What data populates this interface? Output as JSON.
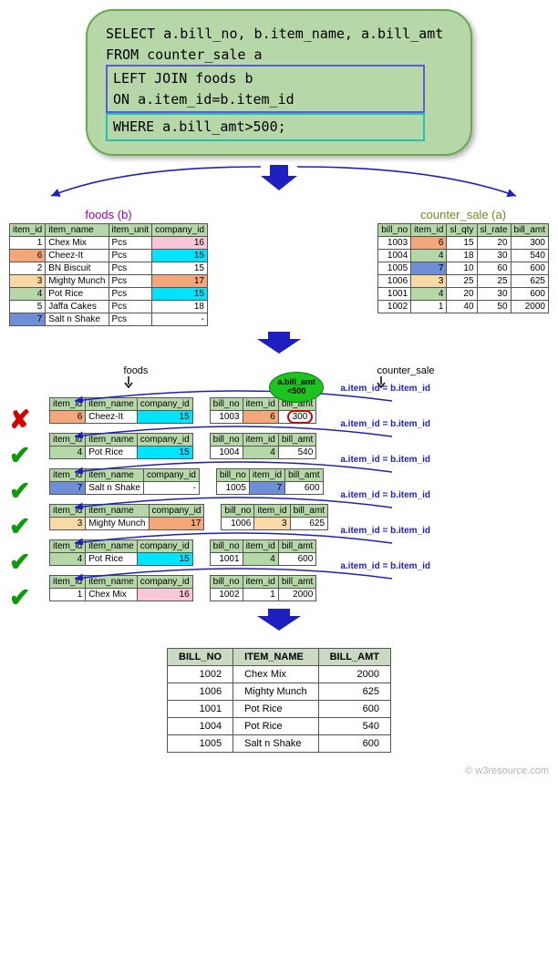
{
  "sql": {
    "line1": "SELECT a.bill_no, b.item_name, a.bill_amt",
    "line2": "FROM counter_sale a",
    "join1": "LEFT JOIN foods b",
    "join2": "ON a.item_id=b.item_id",
    "where": "WHERE  a.bill_amt>500;"
  },
  "labels": {
    "foods_b": "foods (b)",
    "counter_sale_a": "counter_sale (a)",
    "foods": "foods",
    "counter_sale": "counter_sale",
    "join_cond": "a.item_id = b.item_id",
    "bubble": "a.bill_amt\n<500"
  },
  "foods": {
    "headers": [
      "item_id",
      "item_name",
      "item_unit",
      "company_id"
    ],
    "rows": [
      {
        "id": "1",
        "name": "Chex Mix",
        "unit": "Pcs",
        "co": "16",
        "id_bg": "c-white",
        "co_bg": "c-pink"
      },
      {
        "id": "6",
        "name": "Cheez-It",
        "unit": "Pcs",
        "co": "15",
        "id_bg": "c-salmon",
        "co_bg": "c-cyan"
      },
      {
        "id": "2",
        "name": "BN Biscuit",
        "unit": "Pcs",
        "co": "15",
        "id_bg": "c-white",
        "co_bg": "c-white"
      },
      {
        "id": "3",
        "name": "Mighty Munch",
        "unit": "Pcs",
        "co": "17",
        "id_bg": "c-peach",
        "co_bg": "c-salmon"
      },
      {
        "id": "4",
        "name": "Pot Rice",
        "unit": "Pcs",
        "co": "15",
        "id_bg": "c-ltgreen",
        "co_bg": "c-cyan"
      },
      {
        "id": "5",
        "name": "Jaffa Cakes",
        "unit": "Pcs",
        "co": "18",
        "id_bg": "c-white",
        "co_bg": "c-white"
      },
      {
        "id": "7",
        "name": "Salt n Shake",
        "unit": "Pcs",
        "co": "-",
        "id_bg": "c-blue",
        "co_bg": "c-white"
      }
    ]
  },
  "counter": {
    "headers": [
      "bill_no",
      "item_id",
      "sl_qty",
      "sl_rate",
      "bill_amt"
    ],
    "rows": [
      {
        "bill": "1003",
        "item": "6",
        "qty": "15",
        "rate": "20",
        "amt": "300",
        "item_bg": "c-salmon"
      },
      {
        "bill": "1004",
        "item": "4",
        "qty": "18",
        "rate": "30",
        "amt": "540",
        "item_bg": "c-ltgreen"
      },
      {
        "bill": "1005",
        "item": "7",
        "qty": "10",
        "rate": "60",
        "amt": "600",
        "item_bg": "c-blue"
      },
      {
        "bill": "1006",
        "item": "3",
        "qty": "25",
        "rate": "25",
        "amt": "625",
        "item_bg": "c-peach"
      },
      {
        "bill": "1001",
        "item": "4",
        "qty": "20",
        "rate": "30",
        "amt": "600",
        "item_bg": "c-ltgreen"
      },
      {
        "bill": "1002",
        "item": "1",
        "qty": "40",
        "rate": "50",
        "amt": "2000",
        "item_bg": "c-white"
      }
    ]
  },
  "steps": [
    {
      "ok": false,
      "f": {
        "id": "6",
        "name": "Cheez-It",
        "co": "15",
        "id_bg": "c-salmon",
        "co_bg": "c-cyan"
      },
      "c": {
        "bill": "1003",
        "item": "6",
        "amt": "300",
        "item_bg": "c-salmon"
      },
      "circle": true,
      "bubble": true
    },
    {
      "ok": true,
      "f": {
        "id": "4",
        "name": "Pot Rice",
        "co": "15",
        "id_bg": "c-ltgreen",
        "co_bg": "c-cyan"
      },
      "c": {
        "bill": "1004",
        "item": "4",
        "amt": "540",
        "item_bg": "c-ltgreen"
      }
    },
    {
      "ok": true,
      "f": {
        "id": "7",
        "name": "Salt n Shake",
        "co": "-",
        "id_bg": "c-blue",
        "co_bg": "c-white"
      },
      "c": {
        "bill": "1005",
        "item": "7",
        "amt": "600",
        "item_bg": "c-blue"
      }
    },
    {
      "ok": true,
      "f": {
        "id": "3",
        "name": "Mighty Munch",
        "co": "17",
        "id_bg": "c-peach",
        "co_bg": "c-salmon"
      },
      "c": {
        "bill": "1006",
        "item": "3",
        "amt": "625",
        "item_bg": "c-peach"
      }
    },
    {
      "ok": true,
      "f": {
        "id": "4",
        "name": "Pot Rice",
        "co": "15",
        "id_bg": "c-ltgreen",
        "co_bg": "c-cyan"
      },
      "c": {
        "bill": "1001",
        "item": "4",
        "amt": "600",
        "item_bg": "c-ltgreen"
      }
    },
    {
      "ok": true,
      "f": {
        "id": "1",
        "name": "Chex Mix",
        "co": "16",
        "id_bg": "c-white",
        "co_bg": "c-pink"
      },
      "c": {
        "bill": "1002",
        "item": "1",
        "amt": "2000",
        "item_bg": "c-white"
      }
    }
  ],
  "step_f_headers": [
    "item_id",
    "item_name",
    "company_id"
  ],
  "step_c_headers": [
    "bill_no",
    "item_id",
    "bill_amt"
  ],
  "result": {
    "headers": [
      "BILL_NO",
      "ITEM_NAME",
      "BILL_AMT"
    ],
    "rows": [
      {
        "bill": "1002",
        "name": "Chex Mix",
        "amt": "2000"
      },
      {
        "bill": "1006",
        "name": "Mighty Munch",
        "amt": "625"
      },
      {
        "bill": "1001",
        "name": "Pot Rice",
        "amt": "600"
      },
      {
        "bill": "1004",
        "name": "Pot Rice",
        "amt": "540"
      },
      {
        "bill": "1005",
        "name": "Salt n Shake",
        "amt": "600"
      }
    ]
  },
  "footer": "© w3resource.com",
  "chart_data": {
    "type": "table",
    "description": "SQL LEFT JOIN diagram: counter_sale a LEFT JOIN foods b ON a.item_id=b.item_id WHERE a.bill_amt>500",
    "foods_table": [
      {
        "item_id": 1,
        "item_name": "Chex Mix",
        "item_unit": "Pcs",
        "company_id": 16
      },
      {
        "item_id": 6,
        "item_name": "Cheez-It",
        "item_unit": "Pcs",
        "company_id": 15
      },
      {
        "item_id": 2,
        "item_name": "BN Biscuit",
        "item_unit": "Pcs",
        "company_id": 15
      },
      {
        "item_id": 3,
        "item_name": "Mighty Munch",
        "item_unit": "Pcs",
        "company_id": 17
      },
      {
        "item_id": 4,
        "item_name": "Pot Rice",
        "item_unit": "Pcs",
        "company_id": 15
      },
      {
        "item_id": 5,
        "item_name": "Jaffa Cakes",
        "item_unit": "Pcs",
        "company_id": 18
      },
      {
        "item_id": 7,
        "item_name": "Salt n Shake",
        "item_unit": "Pcs",
        "company_id": null
      }
    ],
    "counter_sale_table": [
      {
        "bill_no": 1003,
        "item_id": 6,
        "sl_qty": 15,
        "sl_rate": 20,
        "bill_amt": 300
      },
      {
        "bill_no": 1004,
        "item_id": 4,
        "sl_qty": 18,
        "sl_rate": 30,
        "bill_amt": 540
      },
      {
        "bill_no": 1005,
        "item_id": 7,
        "sl_qty": 10,
        "sl_rate": 60,
        "bill_amt": 600
      },
      {
        "bill_no": 1006,
        "item_id": 3,
        "sl_qty": 25,
        "sl_rate": 25,
        "bill_amt": 625
      },
      {
        "bill_no": 1001,
        "item_id": 4,
        "sl_qty": 20,
        "sl_rate": 30,
        "bill_amt": 600
      },
      {
        "bill_no": 1002,
        "item_id": 1,
        "sl_qty": 40,
        "sl_rate": 50,
        "bill_amt": 2000
      }
    ],
    "result_set": [
      {
        "BILL_NO": 1002,
        "ITEM_NAME": "Chex Mix",
        "BILL_AMT": 2000
      },
      {
        "BILL_NO": 1006,
        "ITEM_NAME": "Mighty Munch",
        "BILL_AMT": 625
      },
      {
        "BILL_NO": 1001,
        "ITEM_NAME": "Pot Rice",
        "BILL_AMT": 600
      },
      {
        "BILL_NO": 1004,
        "ITEM_NAME": "Pot Rice",
        "BILL_AMT": 540
      },
      {
        "BILL_NO": 1005,
        "ITEM_NAME": "Salt n Shake",
        "BILL_AMT": 600
      }
    ]
  }
}
